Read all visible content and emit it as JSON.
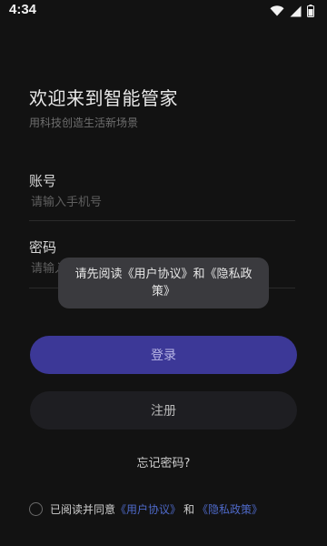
{
  "status_bar": {
    "time": "4:34",
    "icons": [
      "wifi-icon",
      "signal-icon",
      "battery-icon"
    ]
  },
  "welcome": {
    "title": "欢迎来到智能管家",
    "subtitle": "用科技创造生活新场景"
  },
  "form": {
    "account_label": "账号",
    "account_placeholder": "请输入手机号",
    "password_label": "密码",
    "password_placeholder": "请输入密码"
  },
  "buttons": {
    "login": "登录",
    "register": "注册"
  },
  "forgot_password": "忘记密码?",
  "agreement": {
    "prefix": "已阅读并同意",
    "user_agreement": "《用户协议》",
    "conjunction": "和",
    "privacy_policy": "《隐私政策》"
  },
  "toast": {
    "message": "请先阅读《用户协议》和《隐私政策》"
  },
  "colors": {
    "background": "#121212",
    "primary": "#3c3897",
    "link": "#4e69c8"
  }
}
